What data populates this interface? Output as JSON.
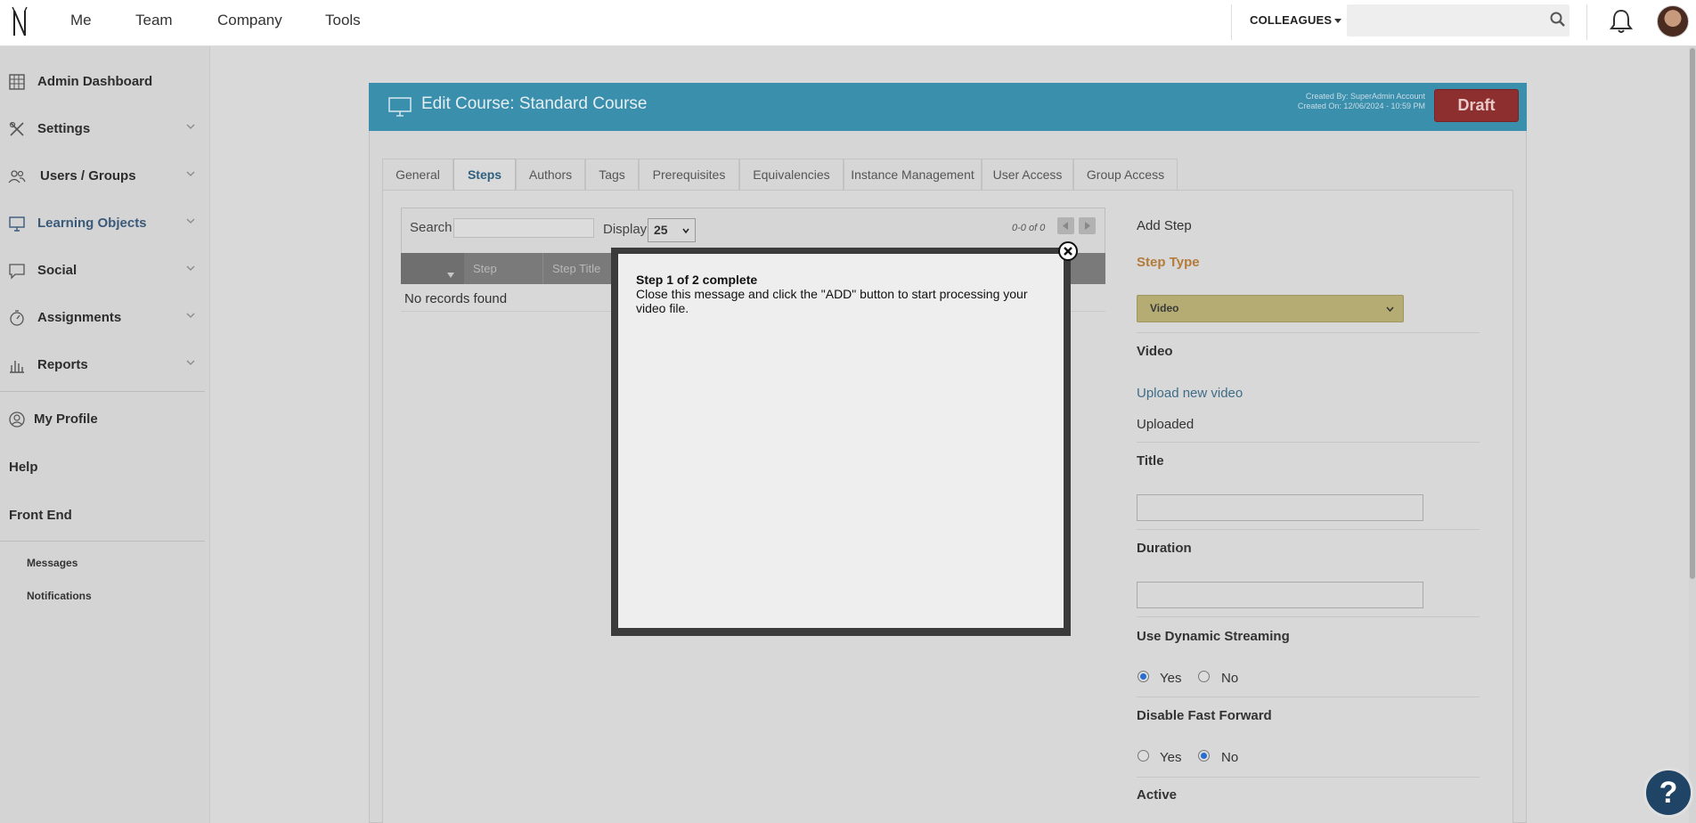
{
  "topnav": {
    "links": [
      "Me",
      "Team",
      "Company",
      "Tools"
    ],
    "colleagues_label": "COLLEAGUES",
    "search_placeholder": ""
  },
  "sidebar": {
    "items": [
      {
        "label": "Admin Dashboard",
        "icon": "dashboard-icon"
      },
      {
        "label": "Settings",
        "icon": "settings-tools-icon"
      },
      {
        "label": "Users / Groups",
        "icon": "users-icon"
      },
      {
        "label": "Learning Objects",
        "icon": "monitor-icon"
      },
      {
        "label": "Social",
        "icon": "chat-icon"
      },
      {
        "label": "Assignments",
        "icon": "stopwatch-icon"
      },
      {
        "label": "Reports",
        "icon": "bar-chart-icon"
      }
    ],
    "my_profile": "My Profile",
    "help": "Help",
    "front_end": "Front End",
    "messages": "Messages",
    "notifications": "Notifications"
  },
  "course": {
    "title": "Edit Course: Standard Course",
    "created_by": "Created By: SuperAdmin Account",
    "created_on": "Created On: 12/06/2024 - 10:59 PM",
    "status_button": "Draft"
  },
  "tabs": [
    "General",
    "Steps",
    "Authors",
    "Tags",
    "Prerequisites",
    "Equivalencies",
    "Instance Management",
    "User Access",
    "Group Access"
  ],
  "active_tab": "Steps",
  "grid": {
    "search_label": "Search",
    "search_value": "",
    "display_label": "Display",
    "display_value": "25",
    "count": "0-0 of 0",
    "columns": [
      "Step",
      "Step Title"
    ],
    "empty_text": "No records found"
  },
  "add_step": {
    "heading": "Add Step",
    "step_type_label": "Step Type",
    "step_type_value": "Video",
    "video_label": "Video",
    "upload_link": "Upload new video",
    "uploaded_text": "Uploaded",
    "title_label": "Title",
    "title_value": "",
    "duration_label": "Duration",
    "duration_value": "",
    "dynamic_label": "Use Dynamic Streaming",
    "dynamic_yes": "Yes",
    "dynamic_no": "No",
    "dynamic_selected": "Yes",
    "ff_label": "Disable Fast Forward",
    "ff_yes": "Yes",
    "ff_no": "No",
    "ff_selected": "No",
    "active_label": "Active"
  },
  "modal": {
    "title": "Step 1 of 2 complete",
    "message": "Close this message and click the \"ADD\" button to start processing your video file."
  },
  "help_button": "?",
  "colors": {
    "header_blue": "#3a8fad",
    "draft_red": "#8e2f2f",
    "step_type_orange": "#b47b3a",
    "link_blue": "#3f6c87"
  }
}
